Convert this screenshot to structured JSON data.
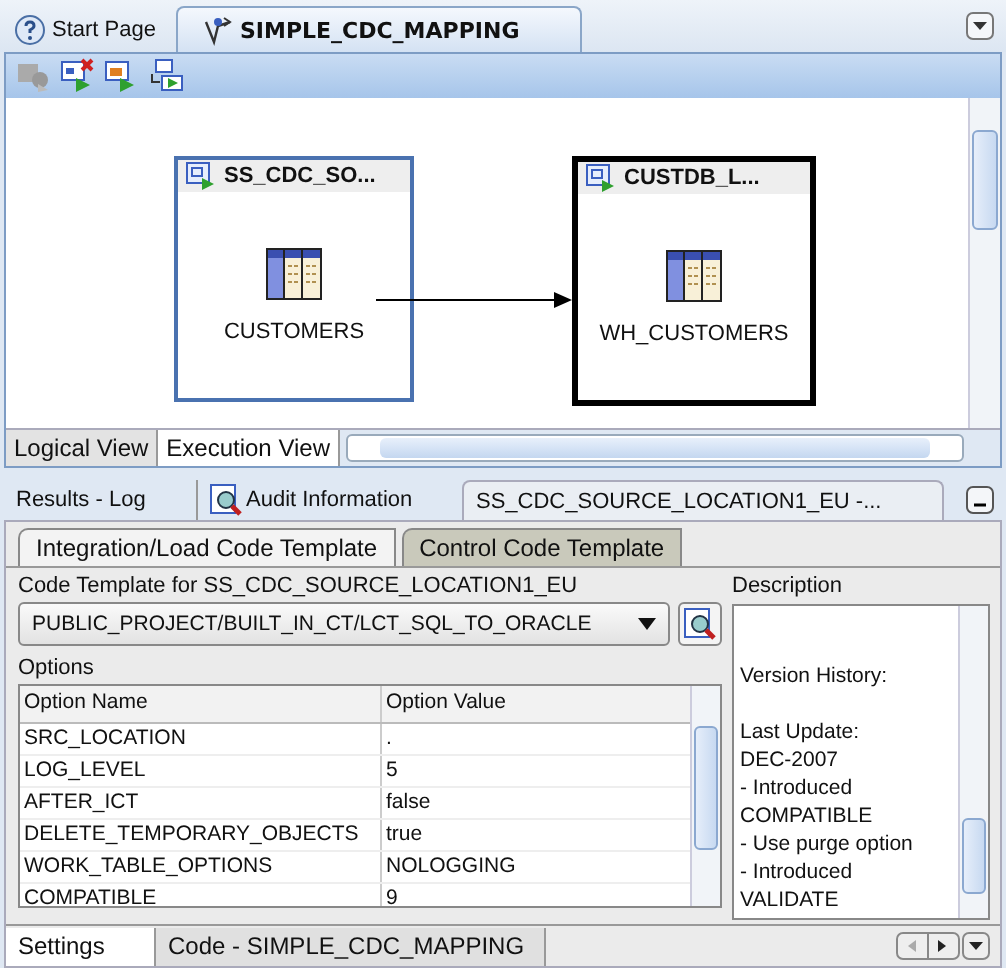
{
  "editor_tabs": [
    {
      "label": "Start Page",
      "selected": false
    },
    {
      "label": "SIMPLE_CDC_MAPPING",
      "selected": true
    }
  ],
  "diagram": {
    "nodes": [
      {
        "title": "SS_CDC_SO...",
        "table": "CUSTOMERS",
        "selected": true
      },
      {
        "title": "CUSTDB_L...",
        "table": "WH_CUSTOMERS",
        "selected": false
      }
    ]
  },
  "view_tabs": [
    {
      "label": "Logical View",
      "selected": false
    },
    {
      "label": "Execution View",
      "selected": true
    }
  ],
  "panel_tabs": [
    {
      "label": "Results - Log",
      "selected": false
    },
    {
      "label": "Audit Information",
      "selected": false
    },
    {
      "label": "SS_CDC_SOURCE_LOCATION1_EU -...",
      "selected": true
    }
  ],
  "sub_tabs": [
    {
      "label": "Integration/Load Code Template",
      "selected": true
    },
    {
      "label": "Control Code Template",
      "selected": false
    }
  ],
  "template_label": "Code Template for SS_CDC_SOURCE_LOCATION1_EU",
  "template_value": "PUBLIC_PROJECT/BUILT_IN_CT/LCT_SQL_TO_ORACLE",
  "options_label": "Options",
  "columns": [
    "Option Name",
    "Option Value"
  ],
  "rows": [
    [
      "SRC_LOCATION",
      "."
    ],
    [
      "LOG_LEVEL",
      "5"
    ],
    [
      "AFTER_ICT",
      "false"
    ],
    [
      "DELETE_TEMPORARY_OBJECTS",
      "true"
    ],
    [
      "WORK_TABLE_OPTIONS",
      "NOLOGGING"
    ],
    [
      "COMPATIBLE",
      "9"
    ]
  ],
  "description_label": "Description",
  "description_lines": [
    "Version History:",
    "Last Update:",
    "DEC-2007",
    "- Introduced",
    "COMPATIBLE",
    "- Use purge option",
    "- Introduced",
    "VALIDATE"
  ],
  "bottom_tabs": [
    {
      "label": "Settings",
      "selected": true
    },
    {
      "label": "Code - SIMPLE_CDC_MAPPING",
      "selected": false
    }
  ]
}
